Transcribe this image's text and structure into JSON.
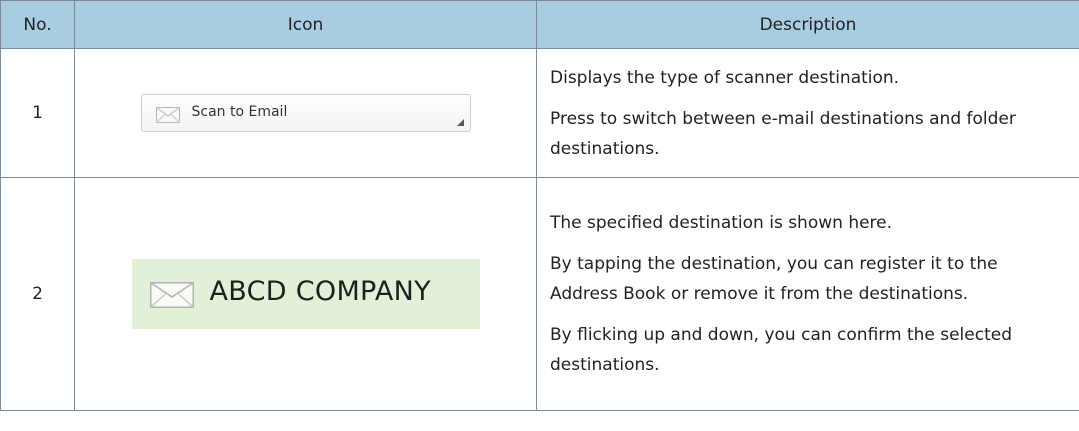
{
  "table": {
    "headers": {
      "no": "No.",
      "icon": "Icon",
      "description": "Description"
    },
    "rows": [
      {
        "no": "1",
        "icon": {
          "name": "envelope-icon",
          "label": "Scan to Email",
          "style": "dropdown"
        },
        "description": [
          "Displays the type of scanner destination.",
          "Press to switch between e-mail destinations and folder destinations."
        ]
      },
      {
        "no": "2",
        "icon": {
          "name": "envelope-icon",
          "label": "ABCD COMPANY",
          "style": "destination-chip",
          "chip_color": "#e2f0d7"
        },
        "description": [
          "The specified destination is shown here.",
          "By tapping the destination, you can register it to the Address Book or remove it from the destinations.",
          "By flicking up and down, you can confirm the selected destinations."
        ]
      }
    ]
  },
  "colors": {
    "header_bg": "#a9cde0",
    "border": "#7a8a96"
  }
}
